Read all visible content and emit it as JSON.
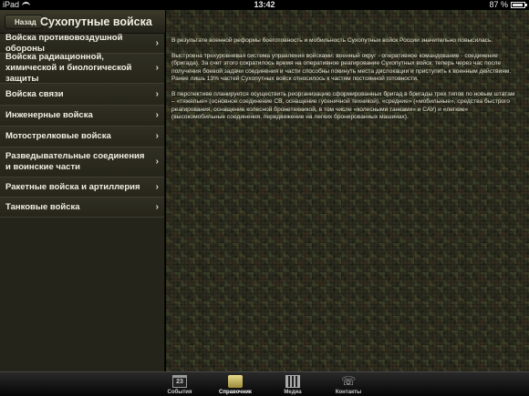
{
  "status": {
    "device": "iPad",
    "time": "13:42",
    "battery": "87 %"
  },
  "nav": {
    "back_label": "Назад",
    "title": "Сухопутные войска"
  },
  "menu": {
    "items": [
      {
        "label": "Войска противовоздушной обороны"
      },
      {
        "label": "Войска радиационной, химической и биологической защиты"
      },
      {
        "label": "Войска связи"
      },
      {
        "label": "Инженерные войска"
      },
      {
        "label": "Мотострелковые войска"
      },
      {
        "label": "Разведывательные соединения и воинские части"
      },
      {
        "label": "Ракетные войска и артиллерия"
      },
      {
        "label": "Танковые войска"
      }
    ],
    "chevron": "›"
  },
  "content": {
    "paragraphs": [
      "В результате военной реформы боеготовность и мобильность Сухопутных войск России значительно повысилась.",
      "Выстроена трехуровневая система управления войсками: военный округ - оперативное командование - соединение (бригада). За счет этого сократилось время на оперативное реагирование Сухопутных войск: теперь через час после получения боевой задачи соединения и части способны покинуть места дислокации и приступить к военным действиям. Ранее лишь 13% частей Сухопутных войск относилось к частям постоянной готовности.",
      "В перспективе планируется осуществить реорганизацию сформированных бригад в бригады трех типов по новым штатам – «тяжелые» (основное соединение СВ, оснащение гусеничной техникой), «средние» («мобильные», средства быстрого реагирования, оснащение колесной бронетехникой, в том числе «колесными танками» и САУ) и «легкие» (высокомобильные соединения, передвижение на легких бронированных машинах)."
    ]
  },
  "tabbar": {
    "tabs": [
      {
        "label": "События",
        "icon": "calendar-icon",
        "icon_text": "23"
      },
      {
        "label": "Справочник",
        "icon": "book-icon"
      },
      {
        "label": "Медиа",
        "icon": "film-icon"
      },
      {
        "label": "Контакты",
        "icon": "phone-icon",
        "icon_text": "☏"
      }
    ],
    "active_index": 1
  }
}
